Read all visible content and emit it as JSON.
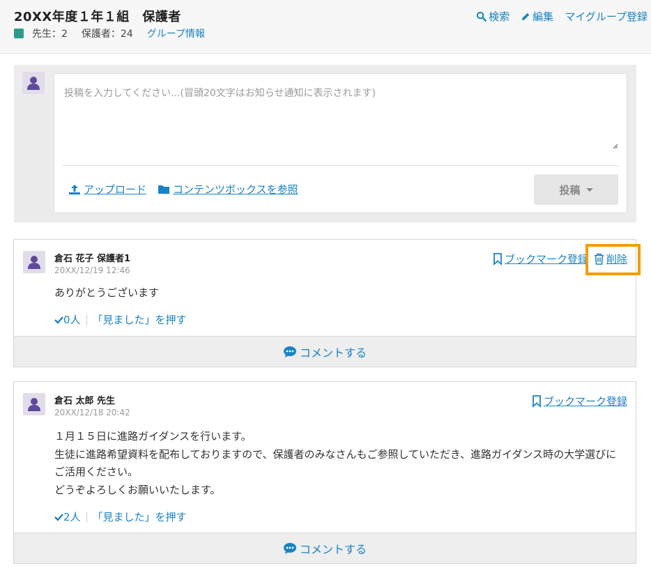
{
  "header": {
    "title": "20XX年度１年１組　保護者",
    "teachers": "先生：2",
    "guardians": "保護者：24",
    "group_info": "グループ情報",
    "search": "検索",
    "edit": "編集",
    "my_group": "マイグループ登録",
    "badge_color": "#2e9a8a"
  },
  "composer": {
    "placeholder": "投稿を入力してください...(冒頭20文字はお知らせ通知に表示されます)",
    "upload": "アップロード",
    "contents_box": "コンテンツボックスを参照",
    "post_button": "投稿"
  },
  "posts": [
    {
      "author": "倉石 花子 保護者1",
      "date": "20XX/12/19 12:46",
      "body": "ありがとうございます",
      "seen_count": "0人",
      "seen_action": "「見ました」を押す",
      "bookmark": "ブックマーク登録",
      "delete": "削除",
      "comment": "コメントする"
    },
    {
      "author": "倉石 太郎 先生",
      "date": "20XX/12/18 20:42",
      "body": "１月１５日に進路ガイダンスを行います。\n生徒に進路希望資料を配布しておりますので、保護者のみなさんもご参照していただき、進路ガイダンス時の大学選びにご活用ください。\nどうぞよろしくお願いいたします。",
      "seen_count": "2人",
      "seen_action": "「見ました」を押す",
      "bookmark": "ブックマーク登録",
      "comment": "コメントする"
    }
  ],
  "colors": {
    "link": "#1a83c4",
    "highlight": "#f29d00"
  }
}
